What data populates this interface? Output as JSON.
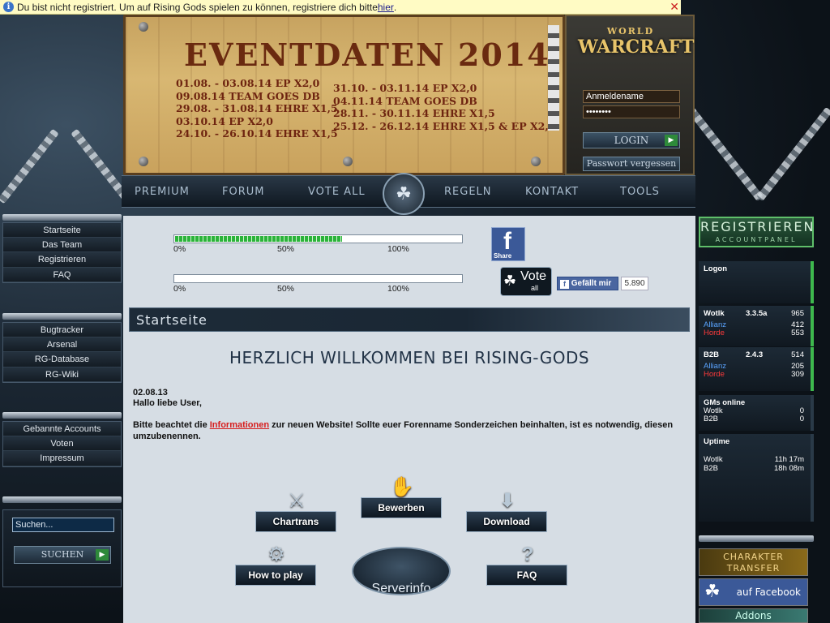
{
  "infobar": {
    "text": "Du bist nicht registriert. Um auf Rising Gods spielen zu können, registriere dich bitte ",
    "link": "hier",
    "end": "."
  },
  "banner": {
    "title": "EVENTDATEN 2014",
    "events_left": [
      "01.08. - 03.08.14 EP X2,0",
      "09.08.14 TEAM GOES DB",
      "29.08. - 31.08.14 EHRE X1,5",
      "03.10.14 EP X2,0",
      "24.10. - 26.10.14 EHRE X1,5"
    ],
    "events_right": [
      "31.10. - 03.11.14 EP X2,0",
      "04.11.14 TEAM GOES DB",
      "28.11. - 30.11.14 EHRE X1,5",
      "25.12. - 26.12.14 EHRE X1,5 & EP X2,0"
    ]
  },
  "login": {
    "logo_small": "WORLD",
    "logo_big": "WARCRAFT",
    "username_value": "Anmeldename",
    "password_value": "••••••••",
    "login_label": "LOGIN",
    "forgot_label": "Passwort vergessen"
  },
  "topnav": [
    "PREMIUM",
    "FORUM",
    "VOTE ALL",
    "REGELN",
    "KONTAKT",
    "TOOLS"
  ],
  "leftmenu": {
    "group1": [
      "Startseite",
      "Das Team",
      "Registrieren",
      "FAQ"
    ],
    "group2": [
      "Bugtracker",
      "Arsenal",
      "RG-Database",
      "RG-Wiki"
    ],
    "group3": [
      "Gebannte Accounts",
      "Voten",
      "Impressum"
    ]
  },
  "search": {
    "placeholder": "Suchen...",
    "button": "SUCHEN"
  },
  "progress": {
    "bar1": {
      "fraction": 0.58,
      "labels": [
        "0%",
        "50%",
        "100%"
      ]
    },
    "bar2": {
      "fraction": 0.0,
      "labels": [
        "0%",
        "50%",
        "100%"
      ]
    }
  },
  "social": {
    "share_label": "Share",
    "vote_label": "Vote",
    "vote_sub": "all",
    "like_label": "Gefällt mir",
    "like_count": "5.890"
  },
  "section": {
    "header": "Startseite"
  },
  "welcome": {
    "title": "HERZLICH WILLKOMMEN BEI RISING-GODS",
    "date": "02.08.13",
    "greeting": "Hallo liebe User,",
    "body_before": "Bitte beachtet die ",
    "body_link": "Informationen",
    "body_after": " zur neuen Website! Sollte euer Forenname Sonderzeichen beinhalten, ist es notwendig, diesen umzubenennen."
  },
  "tiles": {
    "chartrans": "Chartrans",
    "bewerben": "Bewerben",
    "download": "Download",
    "howto": "How to play",
    "serverinfo": "Serverinfo",
    "faq": "FAQ"
  },
  "right": {
    "register": "REGISTRIEREN",
    "register_sub": "ACCOUNTPANEL",
    "logon": "Logon",
    "wotlk": {
      "name": "Wotlk",
      "version": "3.3.5a",
      "total": "965",
      "ally_label": "Allianz",
      "ally": "412",
      "horde_label": "Horde",
      "horde": "553"
    },
    "b2b": {
      "name": "B2B",
      "version": "2.4.3",
      "total": "514",
      "ally_label": "Allianz",
      "ally": "205",
      "horde_label": "Horde",
      "horde": "309"
    },
    "gms": {
      "title": "GMs online",
      "wotlk_label": "Wotlk",
      "wotlk": "0",
      "b2b_label": "B2B",
      "b2b": "0"
    },
    "uptime": {
      "title": "Uptime",
      "wotlk_label": "Wotlk",
      "wotlk": "11h 17m",
      "b2b_label": "B2B",
      "b2b": "18h 08m"
    },
    "chartransfer": "CHARAKTER TRANSFER",
    "facebook": "auf Facebook",
    "addons": "Addons"
  },
  "colors": {
    "accent_green": "#3eb84d",
    "alliance": "#5aa4ff",
    "horde": "#ff3a3a",
    "link_red": "#d71e1e"
  }
}
